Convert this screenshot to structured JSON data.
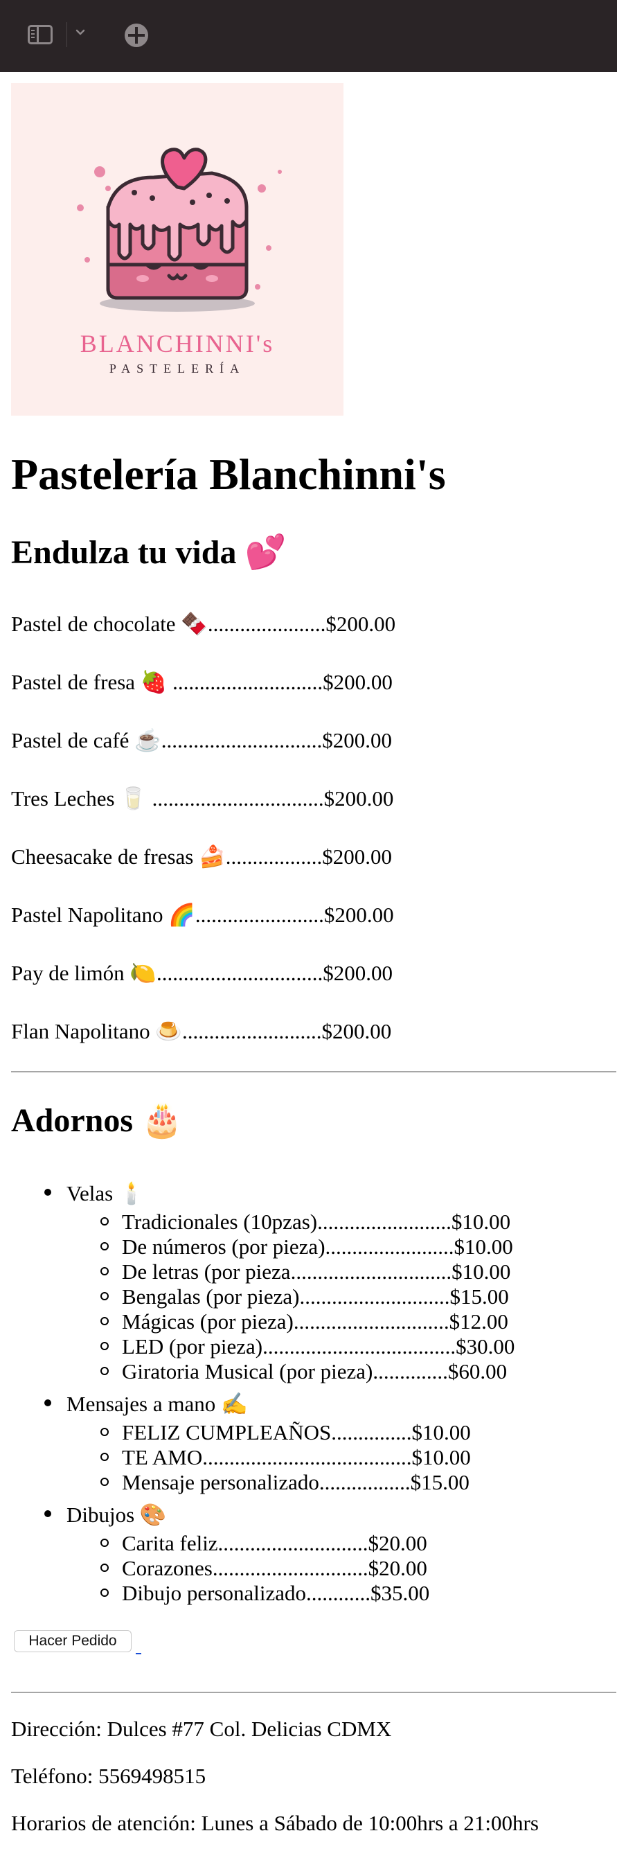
{
  "toolbar": {
    "sidebar_icon": "sidebar-icon",
    "chevron_icon": "chevron-down-icon",
    "app_icon": "app-icon"
  },
  "logo": {
    "name": "BLANCHINNI's",
    "subtitle": "PASTELERÍA",
    "colors": {
      "background": "#fdeeec",
      "pink": "#e8638f",
      "dark": "#3a2b33"
    }
  },
  "page": {
    "title": "Pastelería Blanchinni's",
    "subtitle": "Endulza tu vida 💕"
  },
  "menu": [
    "Pastel de chocolate 🍫......................$200.00",
    "Pastel de fresa 🍓 ............................$200.00",
    "Pastel de café ☕..............................$200.00",
    "Tres Leches 🥛 ................................$200.00",
    "Cheesacake de fresas 🍰..................$200.00",
    "Pastel Napolitano 🌈........................$200.00",
    "Pay de limón 🍋...............................$200.00",
    "Flan Napolitano 🍮..........................$200.00"
  ],
  "adornos": {
    "heading": "Adornos 🎂",
    "categories": [
      {
        "label": "Velas 🕯️",
        "items": [
          "Tradicionales (10pzas).........................$10.00",
          "De números (por pieza)........................$10.00",
          "De letras (por pieza..............................$10.00",
          "Bengalas (por pieza)............................$15.00",
          "Mágicas (por pieza).............................$12.00",
          "LED (por pieza)....................................$30.00",
          "Giratoria Musical (por pieza)..............$60.00"
        ]
      },
      {
        "label": "Mensajes a mano ✍️",
        "items": [
          "FELIZ CUMPLEAÑOS...............$10.00",
          "TE AMO.......................................$10.00",
          "Mensaje personalizado.................$15.00"
        ]
      },
      {
        "label": "Dibujos 🎨",
        "items": [
          "Carita feliz............................$20.00",
          "Corazones.............................$20.00",
          "Dibujo personalizado............$35.00"
        ]
      }
    ]
  },
  "order": {
    "button_label": "Hacer Pedido"
  },
  "footer": {
    "address": "Dirección: Dulces #77 Col. Delicias CDMX",
    "phone": "Teléfono: 5569498515",
    "hours": "Horarios de atención: Lunes a Sábado de 10:00hrs a 21:00hrs"
  }
}
